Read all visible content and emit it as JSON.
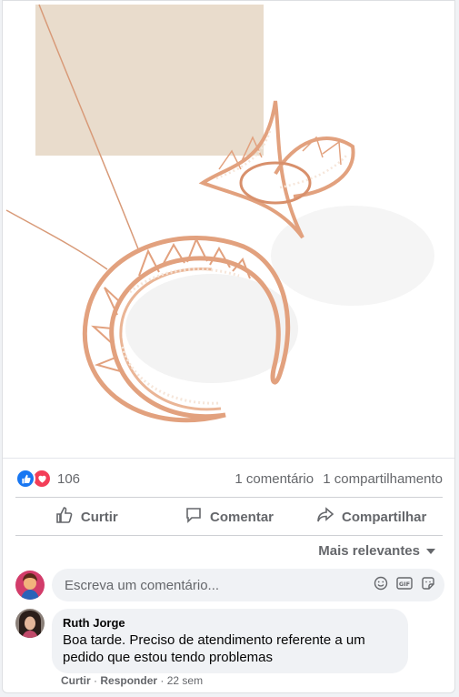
{
  "post": {
    "reactions_count": "106",
    "comments_count": "1 comentário",
    "shares_count": "1 compartilhamento"
  },
  "actions": {
    "like": "Curtir",
    "comment": "Comentar",
    "share": "Compartilhar"
  },
  "sort": {
    "label": "Mais relevantes"
  },
  "composer": {
    "placeholder": "Escreva um comentário..."
  },
  "comment": {
    "author": "Ruth Jorge",
    "text": "Boa tarde. Preciso de atendimento referente a um pedido que estou tendo problemas",
    "like": "Curtir",
    "reply": "Responder",
    "time": "22 sem",
    "separator": "·"
  },
  "colors": {
    "accent": "#1877f2",
    "love": "#f33e58",
    "muted_text": "#65676b",
    "rose_gold": "#e2a17e",
    "beige_backdrop": "#e9dccc"
  },
  "icons": [
    "like-icon",
    "love-icon",
    "thumbs-up-icon",
    "comment-icon",
    "share-icon",
    "chevron-down-icon",
    "emoji-icon",
    "gif-icon",
    "sticker-icon"
  ]
}
